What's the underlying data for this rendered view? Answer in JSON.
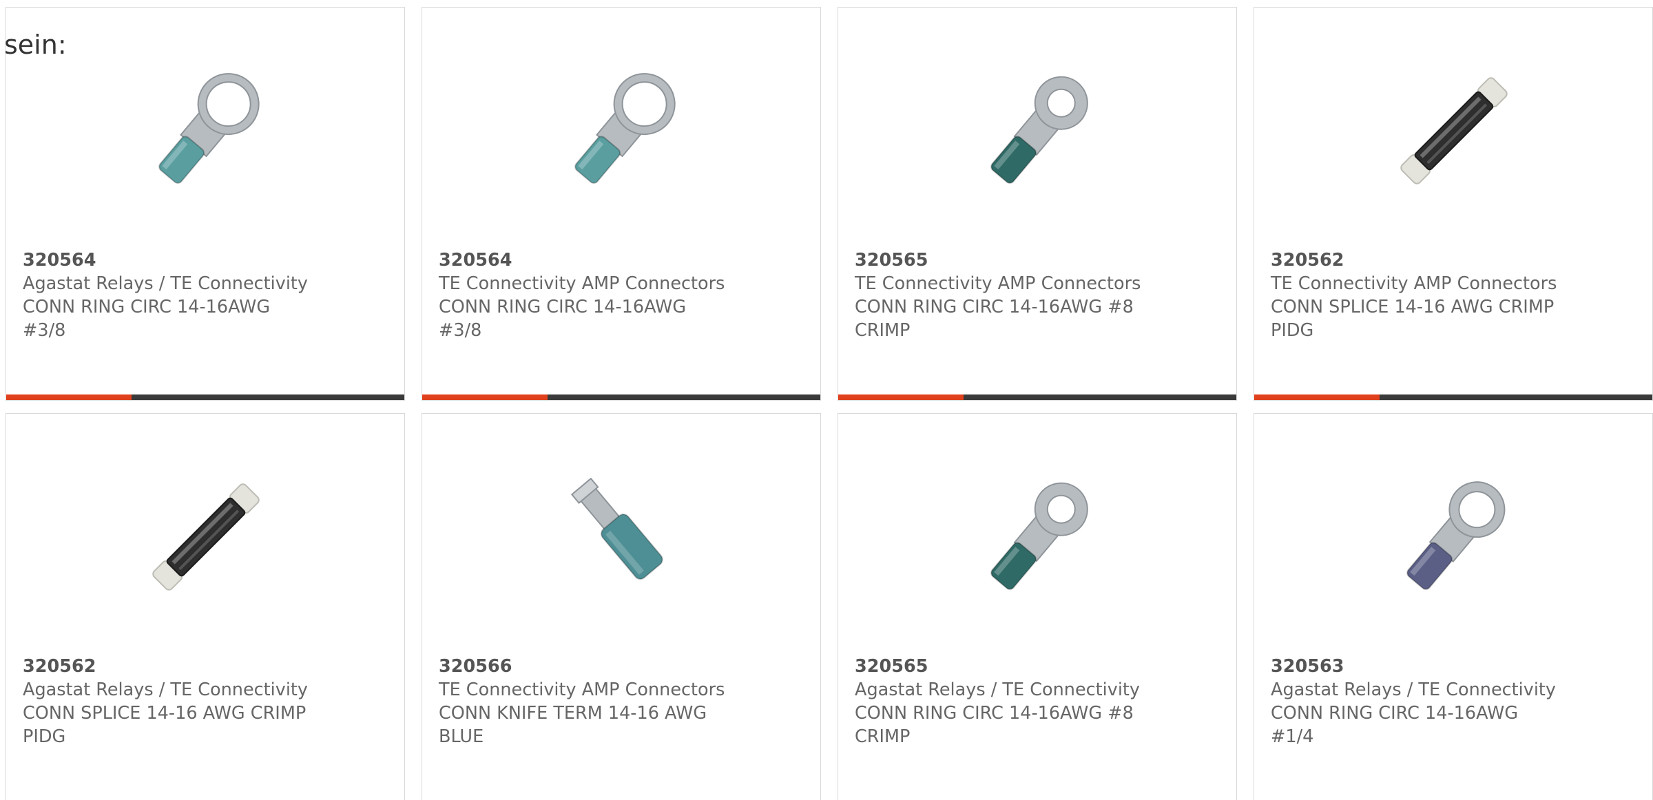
{
  "heading": "sein:",
  "accent_color": "#e0401c",
  "products": [
    {
      "part_number": "320564",
      "manufacturer": "Agastat Relays / TE Connectivity",
      "desc_line1": "CONN RING CIRC 14-16AWG",
      "desc_line2": "#3/8",
      "icon": "ring-terminal-large-icon",
      "insulation_color": "#5a9ea0"
    },
    {
      "part_number": "320564",
      "manufacturer": "TE Connectivity AMP Connectors",
      "desc_line1": "CONN RING CIRC 14-16AWG",
      "desc_line2": "#3/8",
      "icon": "ring-terminal-large-icon",
      "insulation_color": "#5a9ea0"
    },
    {
      "part_number": "320565",
      "manufacturer": "TE Connectivity AMP Connectors",
      "desc_line1": "CONN RING CIRC 14-16AWG #8",
      "desc_line2": "CRIMP",
      "icon": "ring-terminal-small-icon",
      "insulation_color": "#2f6a66"
    },
    {
      "part_number": "320562",
      "manufacturer": "TE Connectivity AMP Connectors",
      "desc_line1": "CONN SPLICE 14-16 AWG CRIMP",
      "desc_line2": "PIDG",
      "icon": "butt-splice-icon",
      "insulation_color": "#2e2e2e"
    },
    {
      "part_number": "320562",
      "manufacturer": "Agastat Relays / TE Connectivity",
      "desc_line1": "CONN SPLICE 14-16 AWG CRIMP",
      "desc_line2": "PIDG",
      "icon": "butt-splice-icon",
      "insulation_color": "#2e2e2e"
    },
    {
      "part_number": "320566",
      "manufacturer": "TE Connectivity AMP Connectors",
      "desc_line1": "CONN KNIFE TERM 14-16 AWG",
      "desc_line2": "BLUE",
      "icon": "knife-terminal-icon",
      "insulation_color": "#4e8f95"
    },
    {
      "part_number": "320565",
      "manufacturer": "Agastat Relays / TE Connectivity",
      "desc_line1": "CONN RING CIRC 14-16AWG #8",
      "desc_line2": "CRIMP",
      "icon": "ring-terminal-small-icon",
      "insulation_color": "#2f6a66"
    },
    {
      "part_number": "320563",
      "manufacturer": "Agastat Relays / TE Connectivity",
      "desc_line1": "CONN RING CIRC 14-16AWG",
      "desc_line2": "#1/4",
      "icon": "ring-terminal-medium-icon",
      "insulation_color": "#5b5f86"
    }
  ]
}
